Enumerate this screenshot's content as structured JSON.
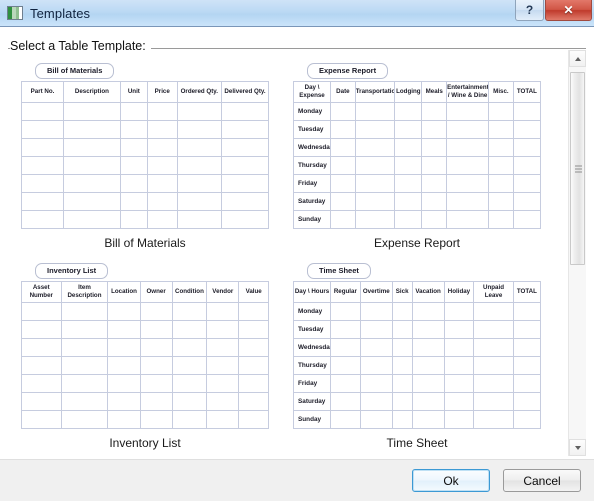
{
  "window": {
    "title": "Templates",
    "icon": "table-template-icon",
    "help_label": "?",
    "close_label": "✕"
  },
  "group": {
    "label": "Select a Table Template:"
  },
  "scrollbar": {
    "up_icon": "scroll-up-arrow-icon",
    "down_icon": "scroll-down-arrow-icon",
    "thumb": "scrollbar-thumb"
  },
  "footer": {
    "ok_label": "Ok",
    "cancel_label": "Cancel"
  },
  "templates": [
    {
      "tab": "Bill of Materials",
      "caption": "Bill of Materials",
      "columns": [
        "Part No.",
        "Description",
        "Unit",
        "Price",
        "Ordered Qty.",
        "Delivered Qty."
      ],
      "col_widths": [
        "17%",
        "23%",
        "11%",
        "12%",
        "18%",
        "19%"
      ],
      "row_labels": [
        "",
        "",
        "",
        "",
        "",
        "",
        ""
      ],
      "has_row_labels": false,
      "rows": 7
    },
    {
      "tab": "Expense Report",
      "caption": "Expense Report",
      "columns": [
        "Day \\ Expense",
        "Date",
        "Transportation",
        "Lodging",
        "Meals",
        "Entertainment / Wine & Dine",
        "Misc.",
        "TOTAL"
      ],
      "col_widths": [
        "15%",
        "10%",
        "16%",
        "11%",
        "10%",
        "17%",
        "10%",
        "11%"
      ],
      "row_labels": [
        "Monday",
        "Tuesday",
        "Wednesday",
        "Thursday",
        "Friday",
        "Saturday",
        "Sunday"
      ],
      "has_row_labels": true,
      "rows": 7
    },
    {
      "tab": "Inventory List",
      "caption": "Inventory List",
      "columns": [
        "Asset Number",
        "Item Description",
        "Location",
        "Owner",
        "Condition",
        "Vendor",
        "Value"
      ],
      "col_widths": [
        "16%",
        "19%",
        "13%",
        "13%",
        "14%",
        "13%",
        "12%"
      ],
      "row_labels": [
        "",
        "",
        "",
        "",
        "",
        "",
        ""
      ],
      "has_row_labels": false,
      "rows": 7
    },
    {
      "tab": "Time Sheet",
      "caption": "Time Sheet",
      "columns": [
        "Day \\ Hours",
        "Regular",
        "Overtime",
        "Sick",
        "Vacation",
        "Holiday",
        "Unpaid Leave",
        "TOTAL"
      ],
      "col_widths": [
        "15%",
        "12%",
        "13%",
        "8%",
        "13%",
        "12%",
        "16%",
        "11%"
      ],
      "row_labels": [
        "Monday",
        "Tuesday",
        "Wednesday",
        "Thursday",
        "Friday",
        "Saturday",
        "Sunday"
      ],
      "has_row_labels": true,
      "rows": 7
    }
  ]
}
